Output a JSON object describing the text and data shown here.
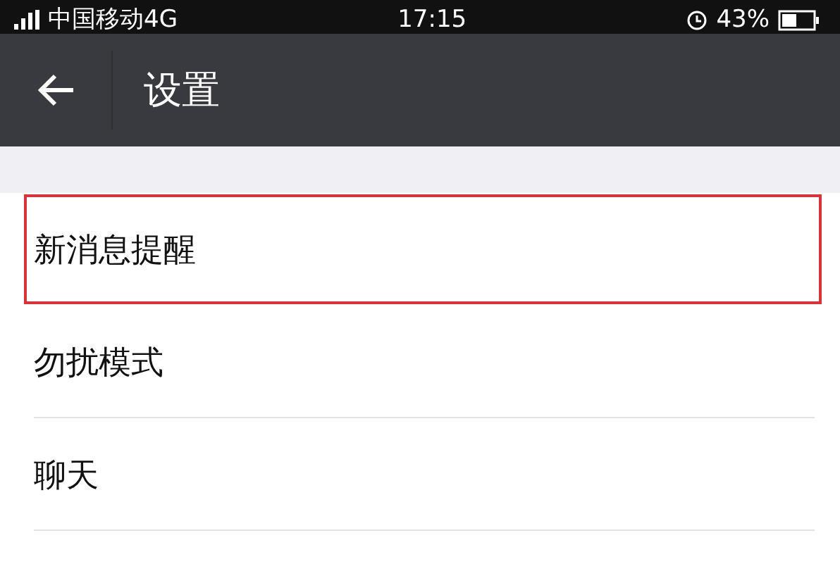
{
  "status_bar": {
    "carrier": "中国移动4G",
    "time": "17:15",
    "battery": "43%"
  },
  "header": {
    "title": "设置"
  },
  "items": [
    {
      "label": "新消息提醒",
      "highlighted": true
    },
    {
      "label": "勿扰模式",
      "highlighted": false
    },
    {
      "label": "聊天",
      "highlighted": false
    }
  ]
}
